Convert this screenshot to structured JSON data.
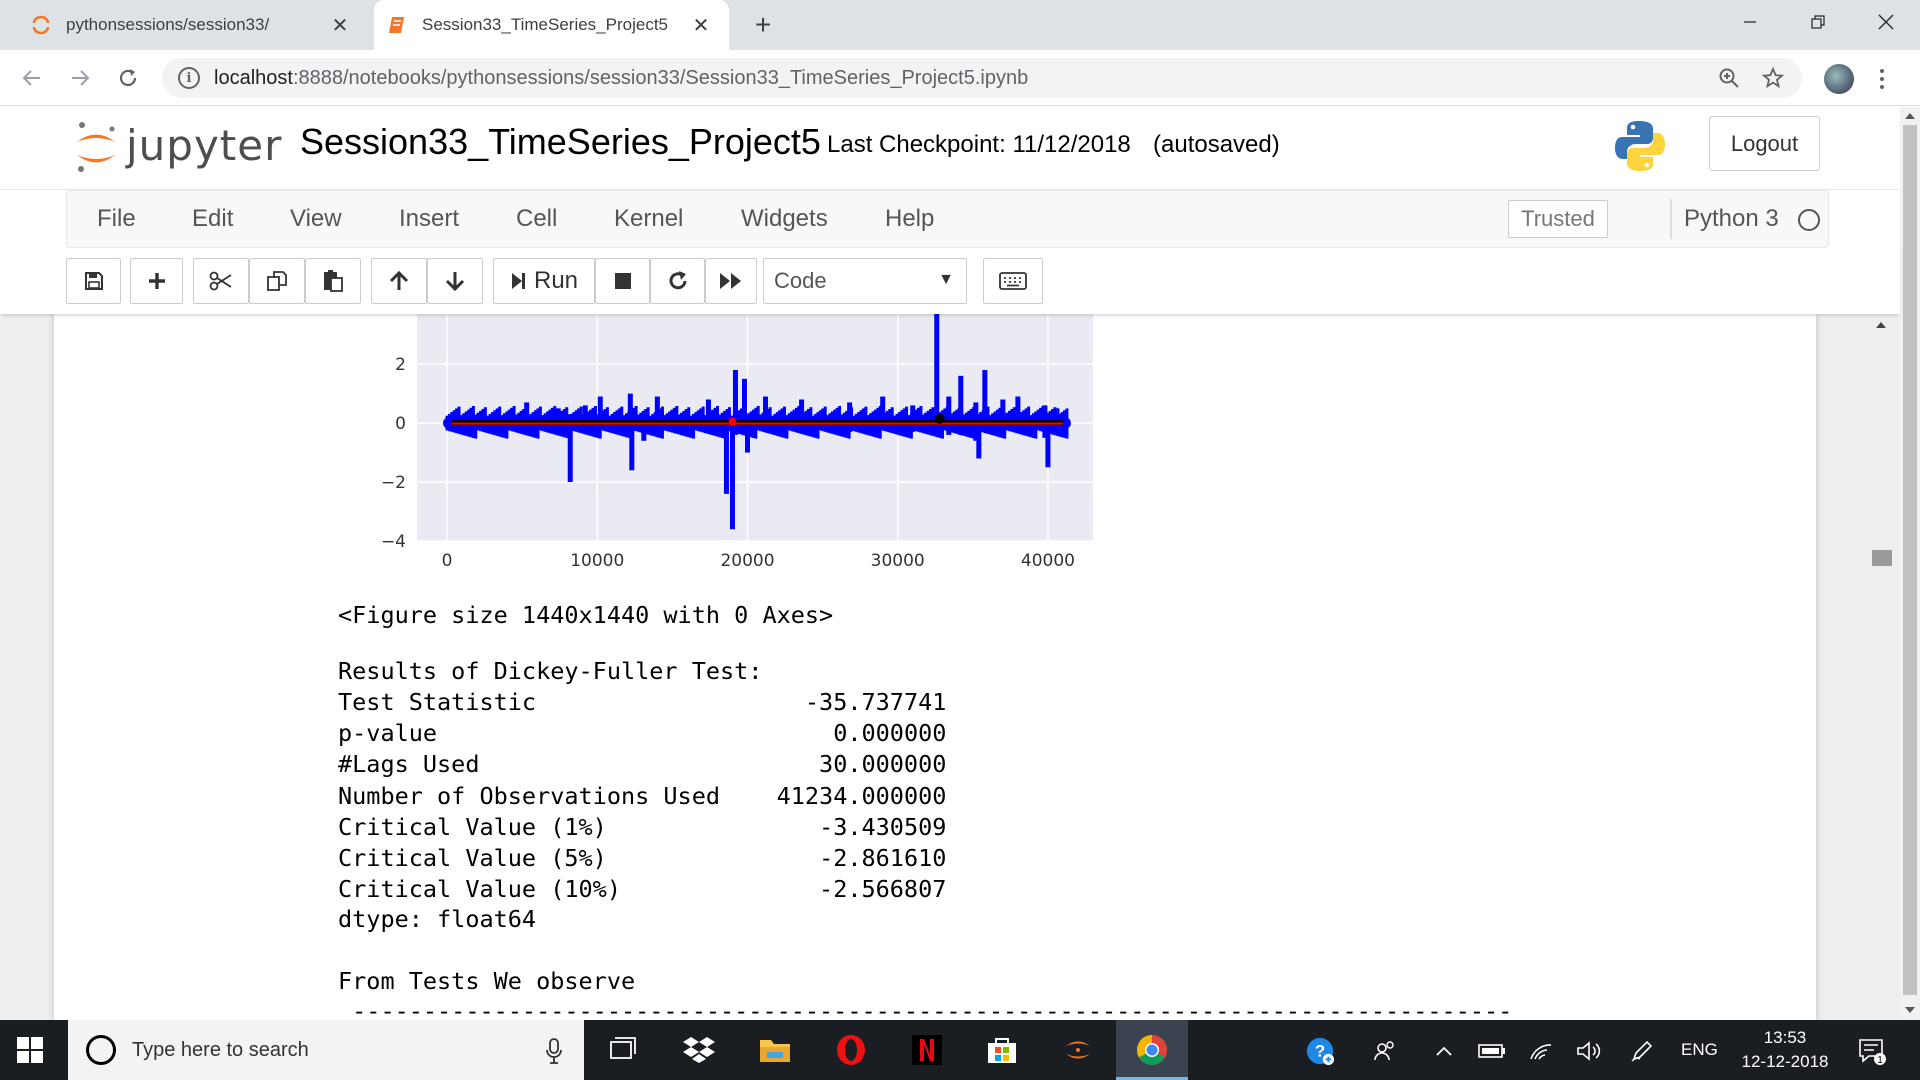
{
  "browser": {
    "tabs": [
      {
        "title": "pythonsessions/session33/",
        "active": false
      },
      {
        "title": "Session33_TimeSeries_Project5",
        "active": true
      }
    ],
    "url_host": "localhost",
    "url_rest": ":8888/notebooks/pythonsessions/session33/Session33_TimeSeries_Project5.ipynb"
  },
  "jupyter": {
    "logo_text": "jupyter",
    "notebook_name": "Session33_TimeSeries_Project5",
    "checkpoint": "Last Checkpoint: 11/12/2018",
    "autosaved": "(autosaved)",
    "logout_label": "Logout",
    "menu": [
      "File",
      "Edit",
      "View",
      "Insert",
      "Cell",
      "Kernel",
      "Widgets",
      "Help"
    ],
    "trusted_label": "Trusted",
    "kernel_name": "Python 3",
    "run_label": "Run",
    "cell_type": "Code"
  },
  "chart_data": {
    "type": "line",
    "x_ticks": [
      "0",
      "10000",
      "20000",
      "30000",
      "40000"
    ],
    "y_ticks": [
      "2",
      "0",
      "−2",
      "−4"
    ],
    "xlim": [
      -2000,
      43000
    ],
    "ylim": [
      -4,
      3.7
    ],
    "series_colors": [
      "#0000ff",
      "#ff0000",
      "#000000"
    ],
    "grid": true,
    "spikes": [
      {
        "x": 5300,
        "lo": -0.3,
        "hi": 0.7
      },
      {
        "x": 7400,
        "lo": -0.2,
        "hi": 0.5
      },
      {
        "x": 8200,
        "lo": -2.0,
        "hi": 0.3
      },
      {
        "x": 9200,
        "lo": -0.3,
        "hi": 0.6
      },
      {
        "x": 10200,
        "lo": -0.2,
        "hi": 0.9
      },
      {
        "x": 12200,
        "lo": -0.4,
        "hi": 1.0
      },
      {
        "x": 12300,
        "lo": -1.6,
        "hi": 0.2
      },
      {
        "x": 13100,
        "lo": -0.6,
        "hi": 0.2
      },
      {
        "x": 14000,
        "lo": -0.2,
        "hi": 0.9
      },
      {
        "x": 17400,
        "lo": -0.3,
        "hi": 0.8
      },
      {
        "x": 18600,
        "lo": -2.4,
        "hi": 0.3
      },
      {
        "x": 19000,
        "lo": -3.6,
        "hi": 0.2
      },
      {
        "x": 19200,
        "lo": -0.4,
        "hi": 1.8
      },
      {
        "x": 19800,
        "lo": -0.3,
        "hi": 1.5
      },
      {
        "x": 20000,
        "lo": -1.0,
        "hi": 0.2
      },
      {
        "x": 21200,
        "lo": -0.2,
        "hi": 0.9
      },
      {
        "x": 23600,
        "lo": -0.3,
        "hi": 0.8
      },
      {
        "x": 26800,
        "lo": -0.3,
        "hi": 0.7
      },
      {
        "x": 29000,
        "lo": -0.2,
        "hi": 0.9
      },
      {
        "x": 31000,
        "lo": -0.3,
        "hi": 0.6
      },
      {
        "x": 32600,
        "lo": -0.2,
        "hi": 3.7
      },
      {
        "x": 33400,
        "lo": -0.4,
        "hi": 0.9
      },
      {
        "x": 34200,
        "lo": -0.4,
        "hi": 1.6
      },
      {
        "x": 35200,
        "lo": -0.6,
        "hi": 0.7
      },
      {
        "x": 35400,
        "lo": -1.2,
        "hi": 0.2
      },
      {
        "x": 35800,
        "lo": -0.3,
        "hi": 1.8
      },
      {
        "x": 37000,
        "lo": -0.3,
        "hi": 0.8
      },
      {
        "x": 38000,
        "lo": -0.2,
        "hi": 0.9
      },
      {
        "x": 39800,
        "lo": -0.5,
        "hi": 0.6
      },
      {
        "x": 40000,
        "lo": -1.5,
        "hi": 0.3
      },
      {
        "x": 40600,
        "lo": -0.4,
        "hi": 0.5
      }
    ]
  },
  "output": {
    "figure_line": "<Figure size 1440x1440 with 0 Axes>",
    "df_title": "Results of Dickey-Fuller Test:",
    "df_rows": [
      {
        "label": "Test Statistic",
        "value": "-35.737741"
      },
      {
        "label": "p-value",
        "value": "0.000000"
      },
      {
        "label": "#Lags Used",
        "value": "30.000000"
      },
      {
        "label": "Number of Observations Used",
        "value": "41234.000000"
      },
      {
        "label": "Critical Value (1%)",
        "value": "-3.430509"
      },
      {
        "label": "Critical Value (5%)",
        "value": "-2.861610"
      },
      {
        "label": "Critical Value (10%)",
        "value": "-2.566807"
      }
    ],
    "dtype_line": "dtype: float64",
    "observe_line": "From Tests We observe",
    "dash_line": " ----------------------------------------------------------------------------------"
  },
  "taskbar": {
    "search_placeholder": "Type here to search",
    "lang": "ENG",
    "time": "13:53",
    "date": "12-12-2018",
    "notification_count": "1"
  }
}
